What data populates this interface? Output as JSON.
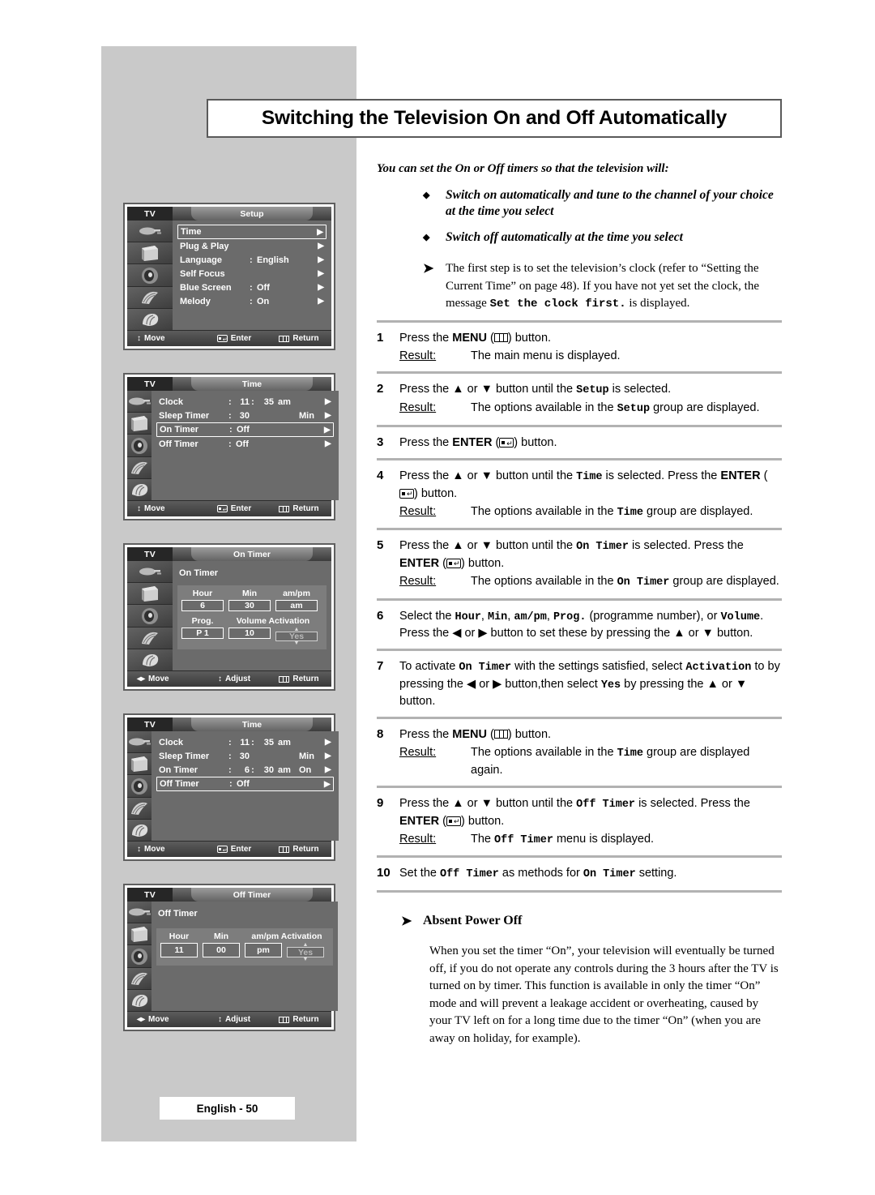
{
  "page": {
    "title": "Switching the Television On and Off Automatically",
    "footer": "English - 50"
  },
  "intro": {
    "lead": "You can set the On or Off timers so that the television will:",
    "bullets": [
      "Switch on automatically and tune to the channel of your choice at the time you select",
      "Switch off automatically at the time you select"
    ],
    "note_pre": "The first step is to set the television’s clock (refer to “Setting the Current Time” on page 48). If you have not yet set the clock,  the message ",
    "note_mono": "Set the clock first.",
    "note_post": " is displayed."
  },
  "steps": [
    {
      "num": "1",
      "pre": "Press the ",
      "bold": "MENU",
      "icon": "menu-icon",
      "post": " button.",
      "result_label": "Result:",
      "result": "The main menu is displayed."
    },
    {
      "num": "2",
      "pre": "Press the ▲ or ▼ button until the ",
      "kbd": "Setup",
      "post": " is selected.",
      "result_label": "Result:",
      "result_pre": "The options available in the ",
      "result_kbd": "Setup",
      "result_post": " group are displayed."
    },
    {
      "num": "3",
      "pre": "Press the ",
      "bold": "ENTER",
      "icon": "enter-icon",
      "post": " button."
    },
    {
      "num": "4",
      "pre": "Press the ▲ or ▼ button until the ",
      "kbd": "Time",
      "mid": " is selected. Press the ",
      "bold": "ENTER",
      "icon": "enter-icon",
      "post": " button.",
      "result_label": "Result:",
      "result_pre": "The options available in the ",
      "result_kbd": "Time",
      "result_post": " group are displayed."
    },
    {
      "num": "5",
      "pre": "Press the ▲ or ▼ button until the ",
      "kbd": "On Timer",
      "mid": " is selected. Press the ",
      "bold": "ENTER",
      "icon": "enter-icon",
      "post": " button.",
      "result_label": "Result:",
      "result_pre": "The options available in the ",
      "result_kbd": "On Timer",
      "result_post": " group are displayed."
    },
    {
      "num": "6",
      "text_a": "Select the ",
      "kbd_a": "Hour",
      "text_b": ", ",
      "kbd_b": "Min",
      "text_c": ", ",
      "kbd_c": "am/pm",
      "text_d": ", ",
      "kbd_d": "Prog.",
      "text_e": " (programme number), or ",
      "kbd_e": "Volume",
      "text_f": ". Press the ◀ or ▶ button to set these by pressing the ▲ or ▼ button."
    },
    {
      "num": "7",
      "text_a": "To activate ",
      "kbd_a": "On Timer",
      "text_b": " with the settings satisfied, select ",
      "kbd_b": "Activation",
      "text_c": " to by pressing the ◀ or ▶ button,then select ",
      "kbd_c": "Yes",
      "text_d": " by pressing the ▲ or ▼ button."
    },
    {
      "num": "8",
      "pre": "Press the ",
      "bold": "MENU",
      "icon": "menu-icon",
      "post": " button.",
      "result_label": "Result:",
      "result_pre": "The options available in the ",
      "result_kbd": "Time",
      "result_post": " group are displayed again."
    },
    {
      "num": "9",
      "pre": "Press the ▲ or ▼ button until the ",
      "kbd": "Off Timer",
      "mid": " is selected. Press the ",
      "bold": "ENTER",
      "icon": "enter-icon",
      "post": " button.",
      "result_label": "Result:",
      "result_pre": "The ",
      "result_kbd": "Off Timer",
      "result_post": " menu is displayed."
    },
    {
      "num": "10",
      "text_a": "Set the ",
      "kbd_a": "Off Timer",
      "text_b": " as methods for ",
      "kbd_b": "On Timer",
      "text_c": " setting."
    }
  ],
  "absent_power_off": {
    "heading": "Absent Power Off",
    "body": "When you set the timer “On”, your television will eventually be turned off, if you do not operate any controls during the 3 hours after the TV is turned on by timer. This function is available in only the timer “On” mode and will prevent a leakage accident or overheating, caused by your TV left on for a long time due to the timer “On”  (when you are away on holiday, for example)."
  },
  "osd_panels": [
    {
      "id": "setup-menu",
      "tv_label": "TV",
      "tab": "Setup",
      "rows": [
        {
          "label": "Time",
          "colon": "",
          "value": "",
          "arrow": "▶",
          "selected": true
        },
        {
          "label": "Plug & Play",
          "colon": "",
          "value": "",
          "arrow": "▶",
          "selected": false
        },
        {
          "label": "Language",
          "colon": ":",
          "value": "English",
          "arrow": "▶",
          "selected": false
        },
        {
          "label": "Self Focus",
          "colon": "",
          "value": "",
          "arrow": "▶",
          "selected": false
        },
        {
          "label": "Blue Screen",
          "colon": ":",
          "value": "Off",
          "arrow": "▶",
          "selected": false
        },
        {
          "label": "Melody",
          "colon": ":",
          "value": "On",
          "arrow": "▶",
          "selected": false
        }
      ],
      "footer": [
        {
          "icon": "updown-icon",
          "label": "Move"
        },
        {
          "icon": "enter-icon",
          "label": "Enter"
        },
        {
          "icon": "menu-icon",
          "label": "Return"
        }
      ]
    },
    {
      "id": "time-menu",
      "tv_label": "TV",
      "tab": "Time",
      "time_rows": [
        {
          "label": "Clock",
          "c": ":",
          "h": "11",
          "sep": ":",
          "m": "35",
          "ampm": "am",
          "extra": "",
          "arrow": "▶",
          "selected": false
        },
        {
          "label": "Sleep Timer",
          "c": ":",
          "h": "30",
          "sep": "",
          "m": "",
          "ampm": "",
          "extra": "Min",
          "arrow": "▶",
          "selected": false
        },
        {
          "label": "On Timer",
          "c": ":",
          "h": "Off",
          "sep": "",
          "m": "",
          "ampm": "",
          "extra": "",
          "arrow": "▶",
          "selected": true
        },
        {
          "label": "Off Timer",
          "c": ":",
          "h": "Off",
          "sep": "",
          "m": "",
          "ampm": "",
          "extra": "",
          "arrow": "▶",
          "selected": false
        }
      ],
      "footer": [
        {
          "icon": "updown-icon",
          "label": "Move"
        },
        {
          "icon": "enter-icon",
          "label": "Enter"
        },
        {
          "icon": "menu-icon",
          "label": "Return"
        }
      ]
    },
    {
      "id": "on-timer",
      "tv_label": "TV",
      "tab": "On Timer",
      "section_title": "On Timer",
      "grid_headers_1": [
        "Hour",
        "Min",
        "am/pm"
      ],
      "grid_values_1": [
        "6",
        "30",
        "am"
      ],
      "grid_headers_2": [
        "Prog.",
        "Volume Activation"
      ],
      "grid_values_2": [
        "P 1",
        "10",
        "Yes"
      ],
      "footer": [
        {
          "icon": "leftright-icon",
          "label": "Move"
        },
        {
          "icon": "updown-icon",
          "label": "Adjust"
        },
        {
          "icon": "menu-icon",
          "label": "Return"
        }
      ]
    },
    {
      "id": "time-menu-2",
      "tv_label": "TV",
      "tab": "Time",
      "time_rows": [
        {
          "label": "Clock",
          "c": ":",
          "h": "11",
          "sep": ":",
          "m": "35",
          "ampm": "am",
          "extra": "",
          "arrow": "▶",
          "selected": false
        },
        {
          "label": "Sleep Timer",
          "c": ":",
          "h": "30",
          "sep": "",
          "m": "",
          "ampm": "",
          "extra": "Min",
          "arrow": "▶",
          "selected": false
        },
        {
          "label": "On Timer",
          "c": ":",
          "h": "6",
          "sep": ":",
          "m": "30",
          "ampm": "am",
          "extra": "On",
          "arrow": "▶",
          "selected": false
        },
        {
          "label": "Off Timer",
          "c": ":",
          "h": "Off",
          "sep": "",
          "m": "",
          "ampm": "",
          "extra": "",
          "arrow": "▶",
          "selected": true
        }
      ],
      "footer": [
        {
          "icon": "updown-icon",
          "label": "Move"
        },
        {
          "icon": "enter-icon",
          "label": "Enter"
        },
        {
          "icon": "menu-icon",
          "label": "Return"
        }
      ]
    },
    {
      "id": "off-timer",
      "tv_label": "TV",
      "tab": "Off Timer",
      "section_title": "Off Timer",
      "grid_headers_1": [
        "Hour",
        "Min",
        "am/pm Activation"
      ],
      "grid_values_1": [
        "11",
        "00",
        "pm",
        "Yes"
      ],
      "footer": [
        {
          "icon": "leftright-icon",
          "label": "Move"
        },
        {
          "icon": "updown-icon",
          "label": "Adjust"
        },
        {
          "icon": "menu-icon",
          "label": "Return"
        }
      ]
    }
  ]
}
